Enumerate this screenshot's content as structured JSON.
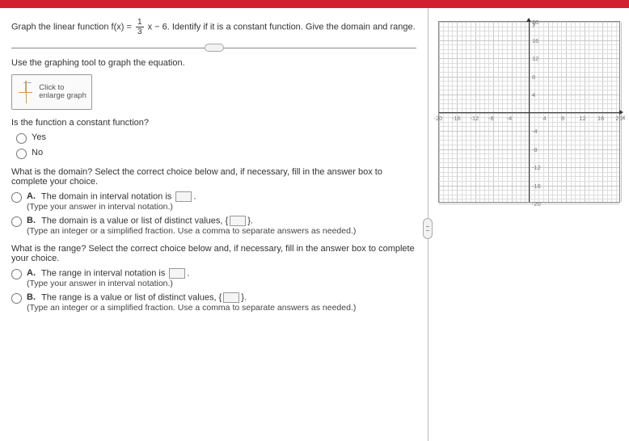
{
  "question": {
    "prefix": "Graph the linear function f(x) = ",
    "frac_num": "1",
    "frac_den": "3",
    "suffix": "x − 6. Identify if it is a constant function. Give the domain and range."
  },
  "instruction": "Use the graphing tool to graph the equation.",
  "graph_button": "Click to enlarge graph",
  "constant_q": "Is the function a constant function?",
  "opt_yes": "Yes",
  "opt_no": "No",
  "domain_q": "What is the domain? Select the correct choice below and, if necessary, fill in the answer box to complete your choice.",
  "domain_a_text": "The domain in interval notation is ",
  "domain_a_hint": "(Type your answer in interval notation.)",
  "domain_b_text_pre": "The domain is a value or list of distinct values, {",
  "domain_b_text_post": "}.",
  "domain_b_hint": "(Type an integer or a simplified fraction. Use a comma to separate answers as needed.)",
  "range_q": "What is the range? Select the correct choice below and, if necessary, fill in the answer box to complete your choice.",
  "range_a_text": "The range in interval notation is ",
  "range_a_hint": "(Type your answer in interval notation.)",
  "range_b_text_pre": "The range is a value or list of distinct values, {",
  "range_b_text_post": "}.",
  "range_b_hint": "(Type an integer or a simplified fraction. Use a comma to separate answers as needed.)",
  "letter_a": "A.",
  "letter_b": "B.",
  "axis_y": "y",
  "axis_x": "x",
  "chart_data": {
    "type": "line",
    "title": "",
    "xlabel": "x",
    "ylabel": "y",
    "xlim": [
      -20,
      20
    ],
    "ylim": [
      -20,
      20
    ],
    "x_ticks": [
      -20,
      -16,
      -12,
      -8,
      -4,
      4,
      8,
      12,
      16,
      20
    ],
    "y_ticks": [
      -20,
      -16,
      -12,
      -8,
      -4,
      4,
      8,
      12,
      16,
      20
    ],
    "series": []
  }
}
